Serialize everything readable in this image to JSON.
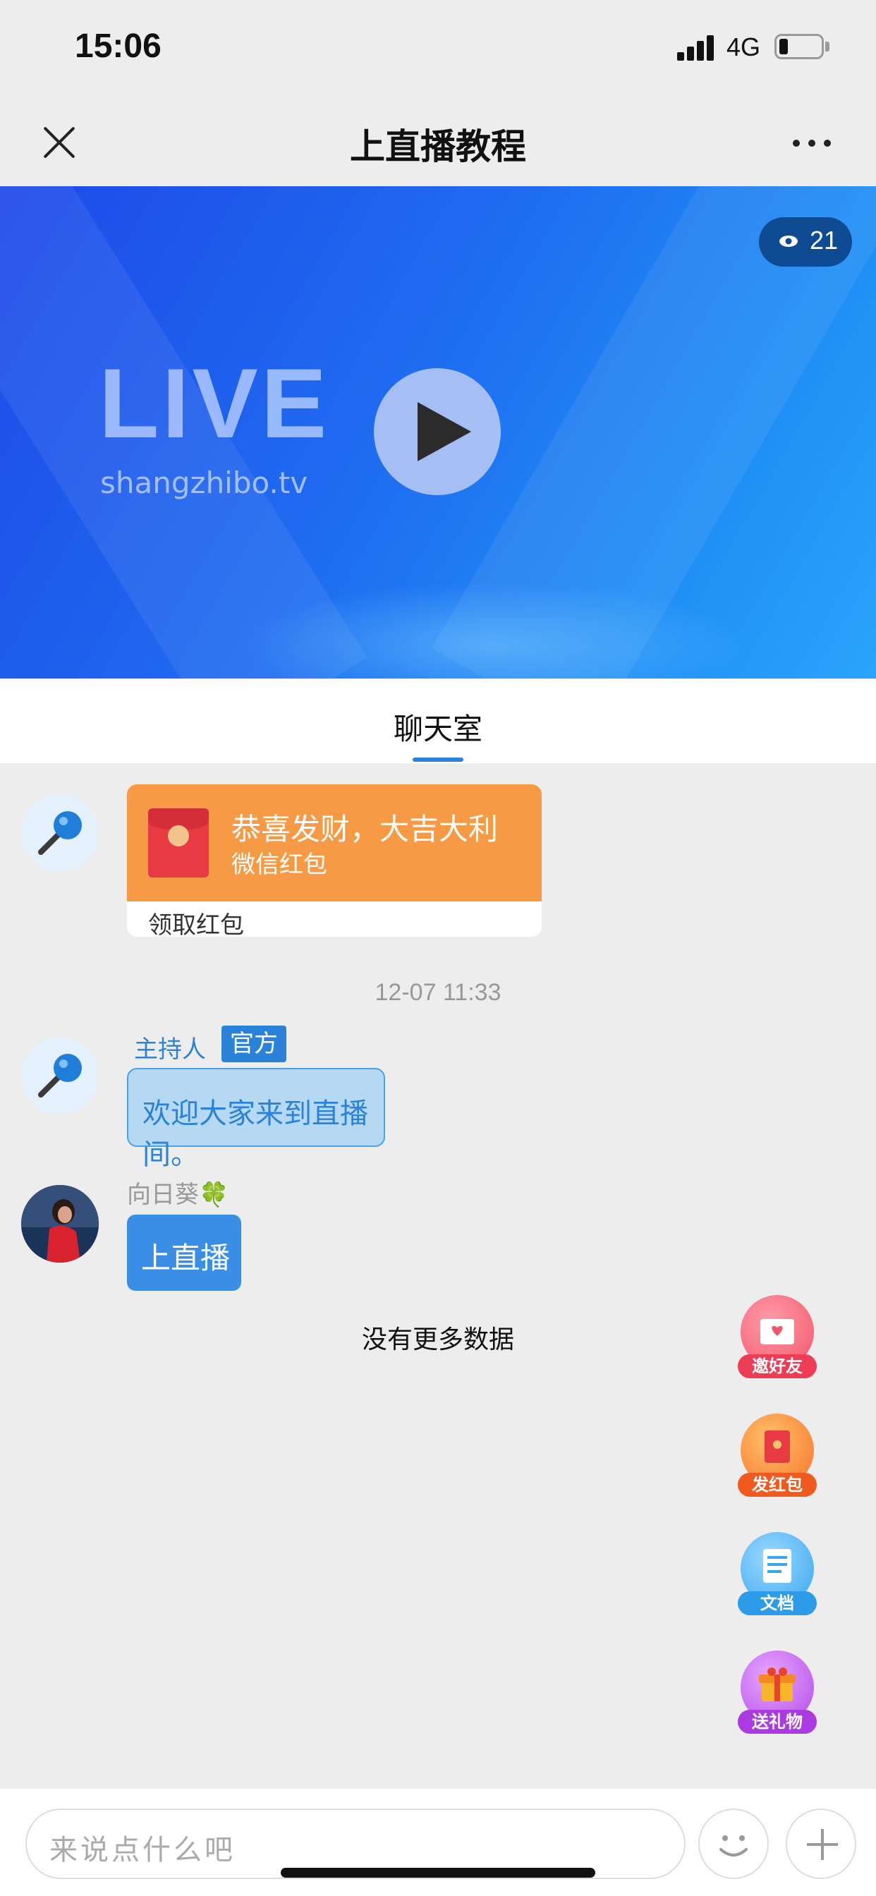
{
  "status_bar": {
    "time": "15:06",
    "network": "4G"
  },
  "nav": {
    "title": "上直播教程"
  },
  "video": {
    "viewer_count": "21",
    "logo_text": "LIVE",
    "logo_site": "shangzhibo.tv"
  },
  "tabs": [
    {
      "label": "聊天室",
      "active": true
    }
  ],
  "chat": {
    "red_packet": {
      "title": "恭喜发财，大吉大利",
      "subtitle": "微信红包",
      "action": "领取红包"
    },
    "timestamp": "12-07 11:33",
    "host_message": {
      "name": "主持人",
      "badge": "官方",
      "text": "欢迎大家来到直播间。"
    },
    "user_message": {
      "name": "向日葵🍀",
      "text": "上直播"
    },
    "end_text": "没有更多数据"
  },
  "fab_buttons": [
    {
      "label": "邀好友",
      "icon": "invite-icon",
      "color": "#f2566a"
    },
    {
      "label": "发红包",
      "icon": "red-packet-icon",
      "color": "#f7732a"
    },
    {
      "label": "文档",
      "icon": "document-icon",
      "color": "#39a7f0"
    },
    {
      "label": "送礼物",
      "icon": "gift-icon",
      "color": "#b54be8"
    }
  ],
  "input": {
    "placeholder": "来说点什么吧"
  },
  "colors": {
    "accent": "#2b82d9",
    "video_bg": "#1f6cf0",
    "red_packet": "#f79a45"
  }
}
